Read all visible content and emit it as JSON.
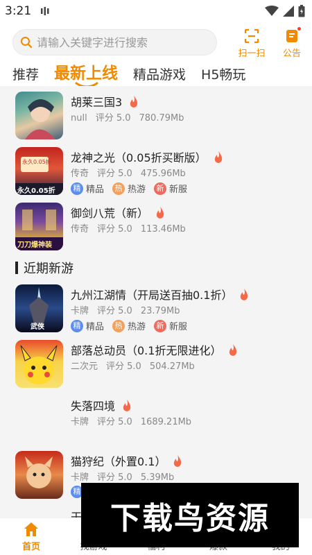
{
  "status": {
    "time": "3:21"
  },
  "search": {
    "placeholder": "请输入关键字进行搜索"
  },
  "header": {
    "scan_label": "扫一扫",
    "notice_label": "公告"
  },
  "tabs": [
    {
      "label": "推荐"
    },
    {
      "label": "最新上线",
      "active": true
    },
    {
      "label": "精品游戏"
    },
    {
      "label": "H5畅玩"
    }
  ],
  "games": [
    {
      "name": "胡莱三国3",
      "category": "null",
      "score": "评分 5.0",
      "size": "780.79Mb",
      "tags": []
    },
    {
      "name": "龙神之光（0.05折买断版）",
      "category": "传奇",
      "score": "评分 5.0",
      "size": "475.96Mb",
      "tags": [
        "精品",
        "热游",
        "新服"
      ]
    },
    {
      "name": "御剑八荒（新）",
      "category": "传奇",
      "score": "评分 5.0",
      "size": "113.46Mb",
      "tags": []
    }
  ],
  "section": {
    "title": "近期新游"
  },
  "recent_games": [
    {
      "name": "九州江湖情（开局送百抽0.1折）",
      "category": "卡牌",
      "score": "评分 5.0",
      "size": "23.79Mb",
      "tags": [
        "精品",
        "热游",
        "新服"
      ]
    },
    {
      "name": "部落总动员（0.1折无限进化）",
      "category": "二次元",
      "score": "评分 5.0",
      "size": "504.27Mb",
      "tags": []
    },
    {
      "name": "失落四境",
      "category": "卡牌",
      "score": "评分 5.0",
      "size": "1689.21Mb",
      "tags": []
    },
    {
      "name": "猫狩纪（外置0.1）",
      "category": "卡牌",
      "score": "评分 5.0",
      "size": "5.39Mb",
      "tags": [
        "精"
      ]
    },
    {
      "name": "干",
      "category": "",
      "score": "",
      "size": "",
      "tags": []
    }
  ],
  "tag_badges": {
    "精品": "精",
    "热游": "热",
    "新服": "新"
  },
  "thumb_text": {
    "g2_top": "永久0.05折",
    "g2_bottom": "永久0.05折",
    "g3_bottom": "刀刀爆神装",
    "r1_bottom": "武侠"
  },
  "nav": [
    {
      "label": "首页",
      "active": true
    },
    {
      "label": "找游戏"
    },
    {
      "label": "福利"
    },
    {
      "label": "爆款"
    },
    {
      "label": "我的"
    }
  ],
  "watermark": "下载鸟资源",
  "colors": {
    "accent": "#f08a00",
    "fire": "#f36a4a",
    "badge_blue": "#5b8cf0",
    "badge_orange": "#f5a05a",
    "badge_red": "#f06a5e"
  }
}
